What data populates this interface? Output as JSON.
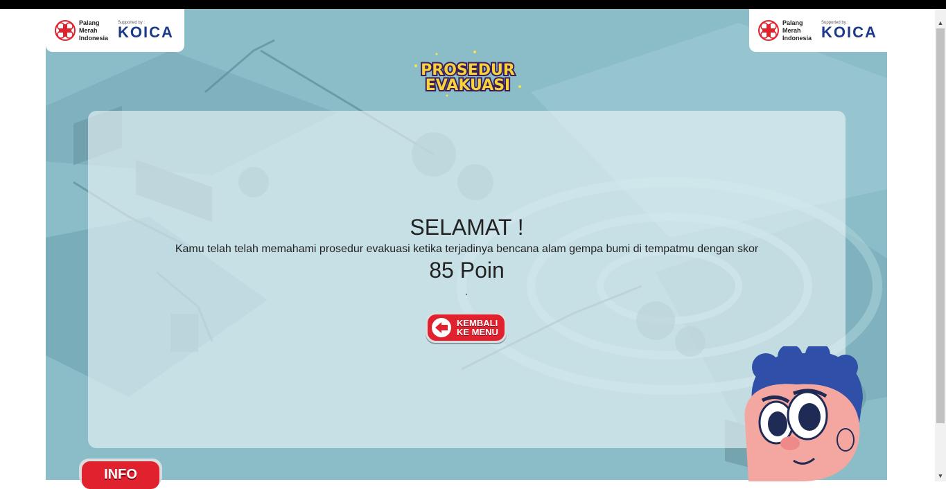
{
  "logos": {
    "pmi_name": "Palang Merah Indonesia",
    "pmi_line1": "Palang",
    "pmi_line2": "Merah",
    "pmi_line3": "Indonesia",
    "supported_by": "Supported by :",
    "koica": "KOICA"
  },
  "title": {
    "line1": "PROSEDUR",
    "line2": "EVAKUASI"
  },
  "result": {
    "heading": "SELAMAT !",
    "message": "Kamu telah telah memahami prosedur evakuasi ketika terjadinya bencana alam gempa bumi di tempatmu dengan skor",
    "score": "85 Poin"
  },
  "buttons": {
    "back_line1": "KEMBALI",
    "back_line2": "KE MENU",
    "info": "INFO"
  },
  "colors": {
    "background": "#8bbdc8",
    "accent_red": "#e0212e",
    "title_yellow": "#f7d23a",
    "koica_blue": "#1d3a8a"
  }
}
